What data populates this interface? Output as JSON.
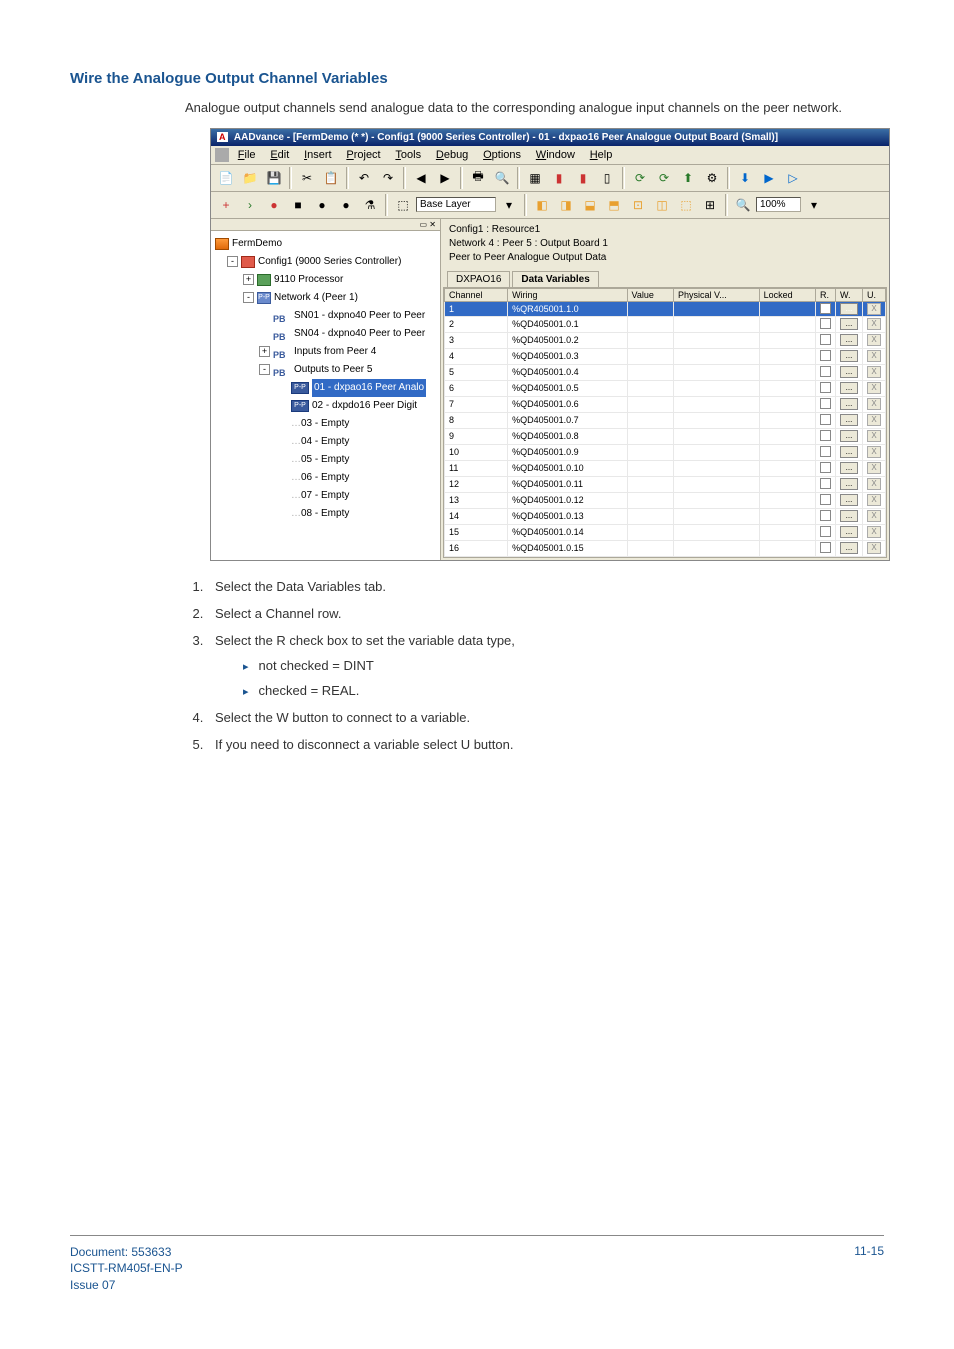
{
  "title": "Wire the Analogue Output Channel Variables",
  "intro": "Analogue output channels send analogue data to the corresponding analogue input channels on the peer network.",
  "app": {
    "titlebar": "AADvance - [FermDemo (* *) - Config1 (9000 Series Controller) - 01 - dxpao16 Peer Analogue Output Board (Small)]",
    "menu": [
      "File",
      "Edit",
      "Insert",
      "Project",
      "Tools",
      "Debug",
      "Options",
      "Window",
      "Help"
    ],
    "layer": "Base Layer",
    "zoom": "100%",
    "tree": {
      "root": "FermDemo",
      "cfg": "Config1 (9000 Series Controller)",
      "proc": "9110 Processor",
      "net": "Network 4 (Peer 1)",
      "items": [
        {
          "type": "pb",
          "label": "SN01 - dxpno40 Peer to Peer",
          "pre": "PB"
        },
        {
          "type": "pb",
          "label": "SN04 - dxpno40 Peer to Peer",
          "pre": "PB"
        },
        {
          "type": "pb",
          "label": "Inputs from Peer 4",
          "pre": "PB",
          "exp": "+"
        },
        {
          "type": "pb",
          "label": "Outputs to Peer 5",
          "pre": "PB",
          "exp": "-"
        }
      ],
      "sub": [
        {
          "type": "pp",
          "label": "01 - dxpao16 Peer Analo",
          "pre": "P-P",
          "sel": true
        },
        {
          "type": "pp",
          "label": "02 - dxpdo16 Peer Digit",
          "pre": "P-P"
        },
        {
          "type": "e",
          "label": "03 - Empty"
        },
        {
          "type": "e",
          "label": "04 - Empty"
        },
        {
          "type": "e",
          "label": "05 - Empty"
        },
        {
          "type": "e",
          "label": "06 - Empty"
        },
        {
          "type": "e",
          "label": "07 - Empty"
        },
        {
          "type": "e",
          "label": "08 - Empty"
        }
      ]
    },
    "rp": {
      "l1": "Config1 : Resource1",
      "l2": "Network 4 : Peer 5 : Output Board 1",
      "l3": "Peer to Peer Analogue Output Data",
      "tabs": [
        "DXPAO16",
        "Data Variables"
      ],
      "headers": [
        "Channel",
        "Wiring",
        "Value",
        "Physical V...",
        "Locked",
        "R.",
        "W.",
        "U."
      ],
      "rows": [
        {
          "c": "1",
          "w": "%QR405001.1.0",
          "sel": true,
          "r": true
        },
        {
          "c": "2",
          "w": "%QD405001.0.1"
        },
        {
          "c": "3",
          "w": "%QD405001.0.2"
        },
        {
          "c": "4",
          "w": "%QD405001.0.3"
        },
        {
          "c": "5",
          "w": "%QD405001.0.4"
        },
        {
          "c": "6",
          "w": "%QD405001.0.5"
        },
        {
          "c": "7",
          "w": "%QD405001.0.6"
        },
        {
          "c": "8",
          "w": "%QD405001.0.7"
        },
        {
          "c": "9",
          "w": "%QD405001.0.8"
        },
        {
          "c": "10",
          "w": "%QD405001.0.9"
        },
        {
          "c": "11",
          "w": "%QD405001.0.10"
        },
        {
          "c": "12",
          "w": "%QD405001.0.11"
        },
        {
          "c": "13",
          "w": "%QD405001.0.12"
        },
        {
          "c": "14",
          "w": "%QD405001.0.13"
        },
        {
          "c": "15",
          "w": "%QD405001.0.14"
        },
        {
          "c": "16",
          "w": "%QD405001.0.15"
        }
      ]
    }
  },
  "steps": [
    "Select the Data Variables tab.",
    "Select a Channel row.",
    "Select the R check box to set the variable data type,",
    "Select the W button to connect to a variable.",
    "If you need to disconnect a variable select U button."
  ],
  "substeps": [
    "not checked  = DINT",
    "checked = REAL."
  ],
  "footer": {
    "doc": "Document: 553633",
    "ref": "ICSTT-RM405f-EN-P",
    "issue": "Issue 07",
    "page": "11-15"
  }
}
